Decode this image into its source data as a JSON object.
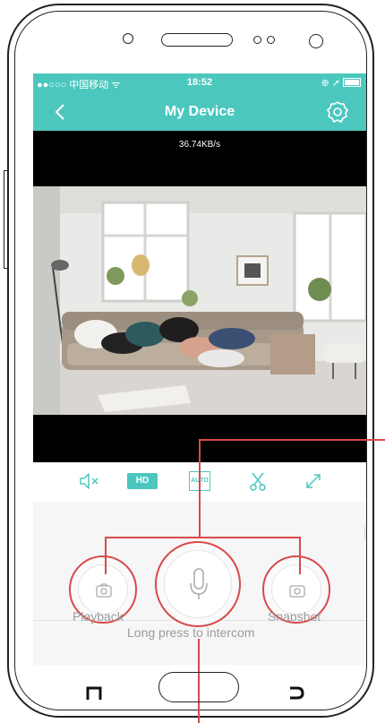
{
  "status_bar": {
    "carrier": "●●○○○ 中国移动 ᯤ",
    "time": "18:52",
    "right": "⊕ ➚"
  },
  "nav": {
    "title": "My Device"
  },
  "video": {
    "speed": "36.74KB/s"
  },
  "controls": {
    "hd_label": "HD",
    "auto_label": "AUTO"
  },
  "actions": {
    "playback_label": "Playback",
    "snapshot_label": "Snapshot",
    "intercom_hint": "Long press to intercom"
  },
  "colors": {
    "accent": "#4bc7be",
    "annotation": "#d84a4a"
  },
  "icons": [
    "back-icon",
    "settings-icon",
    "mute-icon",
    "auto-icon",
    "scissors-icon",
    "fullscreen-icon",
    "playback-icon",
    "microphone-icon",
    "snapshot-icon"
  ]
}
